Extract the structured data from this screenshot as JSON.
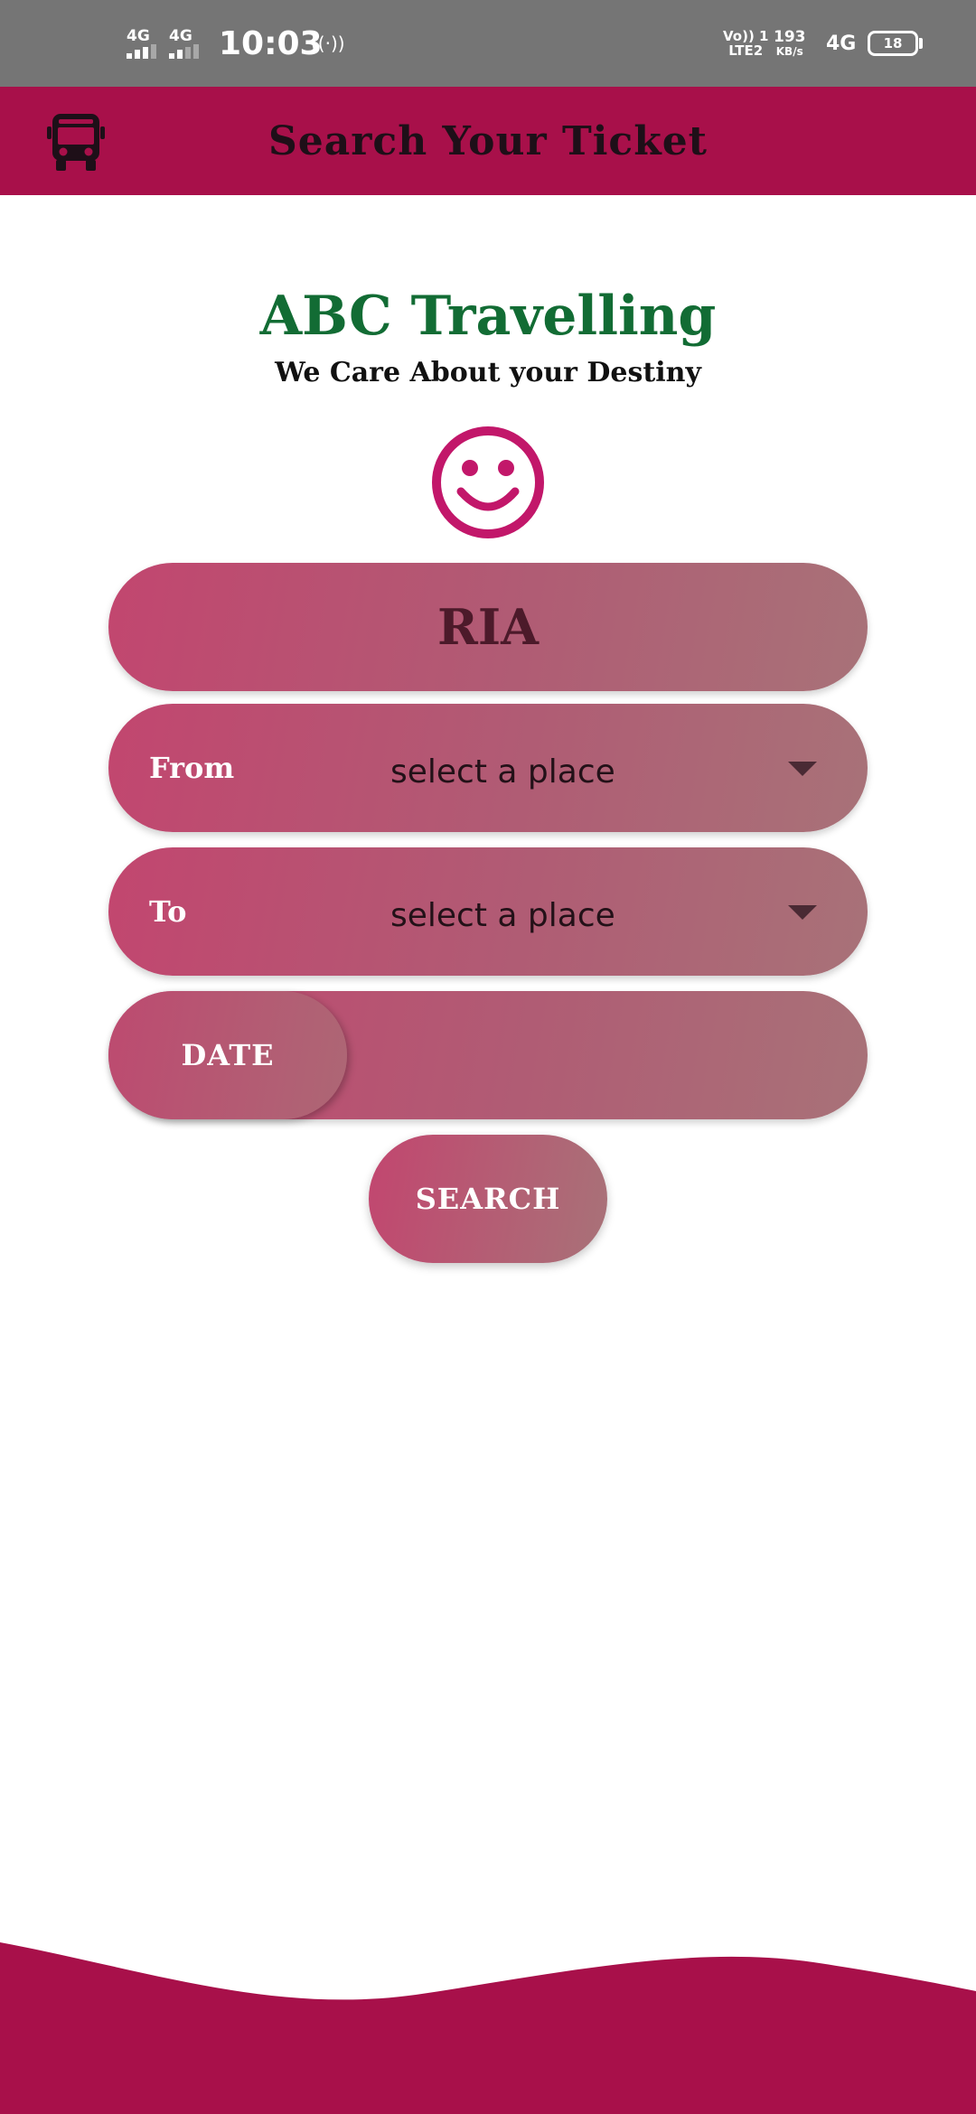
{
  "status_bar": {
    "sim1_label": "4G",
    "sim2_label": "4G",
    "time": "10:03",
    "hotspot_icon": "hotspot-icon",
    "volte_label_top": "Vo)) 1",
    "volte_label_bottom": "LTE2",
    "speed_value": "193",
    "speed_unit": "KB/s",
    "network_label": "4G",
    "battery_level": "18"
  },
  "app_bar": {
    "icon": "bus-icon",
    "title": "Search Your Ticket"
  },
  "brand": {
    "name": "ABC Travelling",
    "tagline": "We Care About your Destiny",
    "emblem": "smiley-icon"
  },
  "form": {
    "user_name": "RIA",
    "from_label": "From",
    "from_value": "select a place",
    "to_label": "To",
    "to_value": "select a place",
    "date_label": "DATE",
    "date_value": "",
    "search_label": "SEARCH"
  },
  "colors": {
    "primary": "#a8104a",
    "brand_green": "#126c34",
    "status_bar": "#757575",
    "accent_pink": "#c2176a"
  }
}
